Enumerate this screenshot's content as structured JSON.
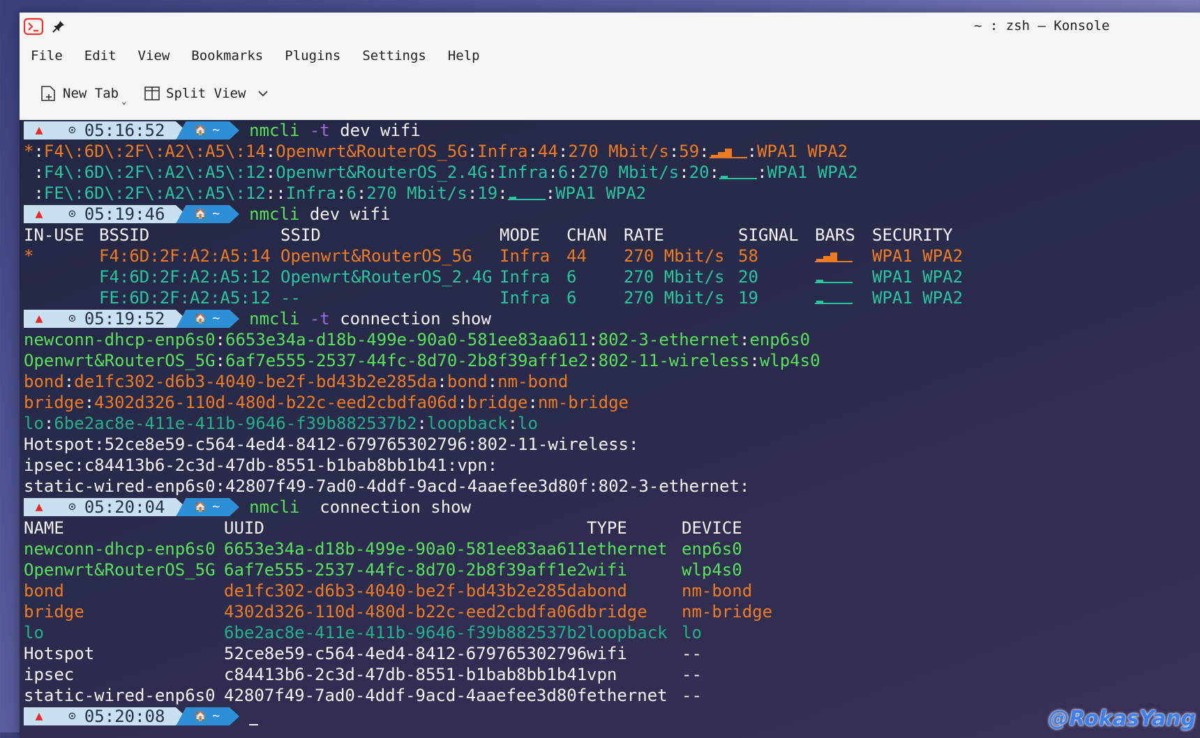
{
  "window": {
    "title": "~ : zsh — Konsole"
  },
  "menu": [
    "File",
    "Edit",
    "View",
    "Bookmarks",
    "Plugins",
    "Settings",
    "Help"
  ],
  "toolbar": {
    "new_tab": "New Tab",
    "split_view": "Split View"
  },
  "prompts": [
    {
      "time": "05:16:52",
      "path": "~",
      "cmd": "nmcli",
      "flag": "-t",
      "args": " dev wifi"
    },
    {
      "time": "05:19:46",
      "path": "~",
      "cmd": "nmcli",
      "flag": "",
      "args": " dev wifi"
    },
    {
      "time": "05:19:52",
      "path": "~",
      "cmd": "nmcli",
      "flag": "-t",
      "args": " connection show"
    },
    {
      "time": "05:20:04",
      "path": "~",
      "cmd": "nmcli",
      "flag": "",
      "args": "  connection show"
    },
    {
      "time": "05:20:08",
      "path": "~",
      "cmd": "",
      "flag": "",
      "args": ""
    }
  ],
  "wifi_terse": [
    {
      "inuse": "*",
      "bssid": "F4\\:6D\\:2F\\:A2\\:A5\\:14",
      "ssid": "Openwrt&RouterOS_5G",
      "mode": "Infra",
      "chan": "44",
      "rate": "270 Mbit/s",
      "signal": "59",
      "bars_level": 0.75,
      "security": "WPA1 WPA2",
      "color": "orange"
    },
    {
      "inuse": " ",
      "bssid": "F4\\:6D\\:2F\\:A2\\:A5\\:12",
      "ssid": "Openwrt&RouterOS_2.4G",
      "mode": "Infra",
      "chan": "6",
      "rate": "270 Mbit/s",
      "signal": "20",
      "bars_level": 0.25,
      "security": "WPA1 WPA2",
      "color": "teal"
    },
    {
      "inuse": " ",
      "bssid": "FE\\:6D\\:2F\\:A2\\:A5\\:12",
      "ssid": "",
      "mode": "Infra",
      "chan": "6",
      "rate": "270 Mbit/s",
      "signal": "19",
      "bars_level": 0.25,
      "security": "WPA1 WPA2",
      "color": "teal"
    }
  ],
  "wifi_table": {
    "headers": [
      "IN-USE",
      "BSSID",
      "SSID",
      "MODE",
      "CHAN",
      "RATE",
      "SIGNAL",
      "BARS",
      "SECURITY"
    ],
    "rows": [
      {
        "inuse": "*",
        "bssid": "F4:6D:2F:A2:A5:14",
        "ssid": "Openwrt&RouterOS_5G",
        "mode": "Infra",
        "chan": "44",
        "rate": "270 Mbit/s",
        "signal": "58",
        "bars_level": 0.75,
        "security": "WPA1 WPA2",
        "color": "orange"
      },
      {
        "inuse": "",
        "bssid": "F4:6D:2F:A2:A5:12",
        "ssid": "Openwrt&RouterOS_2.4G",
        "mode": "Infra",
        "chan": "6",
        "rate": "270 Mbit/s",
        "signal": "20",
        "bars_level": 0.25,
        "security": "WPA1 WPA2",
        "color": "teal"
      },
      {
        "inuse": "",
        "bssid": "FE:6D:2F:A2:A5:12",
        "ssid": "--",
        "mode": "Infra",
        "chan": "6",
        "rate": "270 Mbit/s",
        "signal": "19",
        "bars_level": 0.25,
        "security": "WPA1 WPA2",
        "color": "teal"
      }
    ]
  },
  "conn_terse": [
    {
      "name": "newconn-dhcp-enp6s0",
      "uuid": "6653e34a-d18b-499e-90a0-581ee83aa611",
      "type": "802-3-ethernet",
      "device": "enp6s0",
      "color": "green"
    },
    {
      "name": "Openwrt&RouterOS_5G",
      "uuid": "6af7e555-2537-44fc-8d70-2b8f39aff1e2",
      "type": "802-11-wireless",
      "device": "wlp4s0",
      "color": "green"
    },
    {
      "name": "bond",
      "uuid": "de1fc302-d6b3-4040-be2f-bd43b2e285da",
      "type": "bond",
      "device": "nm-bond",
      "color": "orange"
    },
    {
      "name": "bridge",
      "uuid": "4302d326-110d-480d-b22c-eed2cbdfa06d",
      "type": "bridge",
      "device": "nm-bridge",
      "color": "orange"
    },
    {
      "name": "lo",
      "uuid": "6be2ac8e-411e-411b-9646-f39b882537b2",
      "type": "loopback",
      "device": "lo",
      "color": "darkgreen"
    },
    {
      "name": "Hotspot",
      "uuid": "52ce8e59-c564-4ed4-8412-679765302796",
      "type": "802-11-wireless",
      "device": "",
      "color": "white"
    },
    {
      "name": "ipsec",
      "uuid": "c84413b6-2c3d-47db-8551-b1bab8bb1b41",
      "type": "vpn",
      "device": "",
      "color": "white"
    },
    {
      "name": "static-wired-enp6s0",
      "uuid": "42807f49-7ad0-4ddf-9acd-4aaefee3d80f",
      "type": "802-3-ethernet",
      "device": "",
      "color": "white"
    }
  ],
  "conn_table": {
    "headers": [
      "NAME",
      "UUID",
      "TYPE",
      "DEVICE"
    ],
    "rows": [
      {
        "name": "newconn-dhcp-enp6s0",
        "uuid": "6653e34a-d18b-499e-90a0-581ee83aa611",
        "type": "ethernet",
        "device": "enp6s0",
        "color": "green"
      },
      {
        "name": "Openwrt&RouterOS_5G",
        "uuid": "6af7e555-2537-44fc-8d70-2b8f39aff1e2",
        "type": "wifi",
        "device": "wlp4s0",
        "color": "green"
      },
      {
        "name": "bond",
        "uuid": "de1fc302-d6b3-4040-be2f-bd43b2e285da",
        "type": "bond",
        "device": "nm-bond",
        "color": "orange"
      },
      {
        "name": "bridge",
        "uuid": "4302d326-110d-480d-b22c-eed2cbdfa06d",
        "type": "bridge",
        "device": "nm-bridge",
        "color": "orange"
      },
      {
        "name": "lo",
        "uuid": "6be2ac8e-411e-411b-9646-f39b882537b2",
        "type": "loopback",
        "device": "lo",
        "color": "darkgreen"
      },
      {
        "name": "Hotspot",
        "uuid": "52ce8e59-c564-4ed4-8412-679765302796",
        "type": "wifi",
        "device": "--",
        "color": "white"
      },
      {
        "name": "ipsec",
        "uuid": "c84413b6-2c3d-47db-8551-b1bab8bb1b41",
        "type": "vpn",
        "device": "--",
        "color": "white"
      },
      {
        "name": "static-wired-enp6s0",
        "uuid": "42807f49-7ad0-4ddf-9acd-4aaefee3d80f",
        "type": "ethernet",
        "device": "--",
        "color": "white"
      }
    ]
  },
  "colors": {
    "green": "#59e15a",
    "orange": "#ef7b22",
    "darkgreen": "#25b08a",
    "teal": "#29c4a0",
    "white": "#f2f2f2",
    "prompt_bg": "#c8e0f0",
    "path_bg": "#2f8fd6"
  },
  "watermark": "@RokasYang"
}
